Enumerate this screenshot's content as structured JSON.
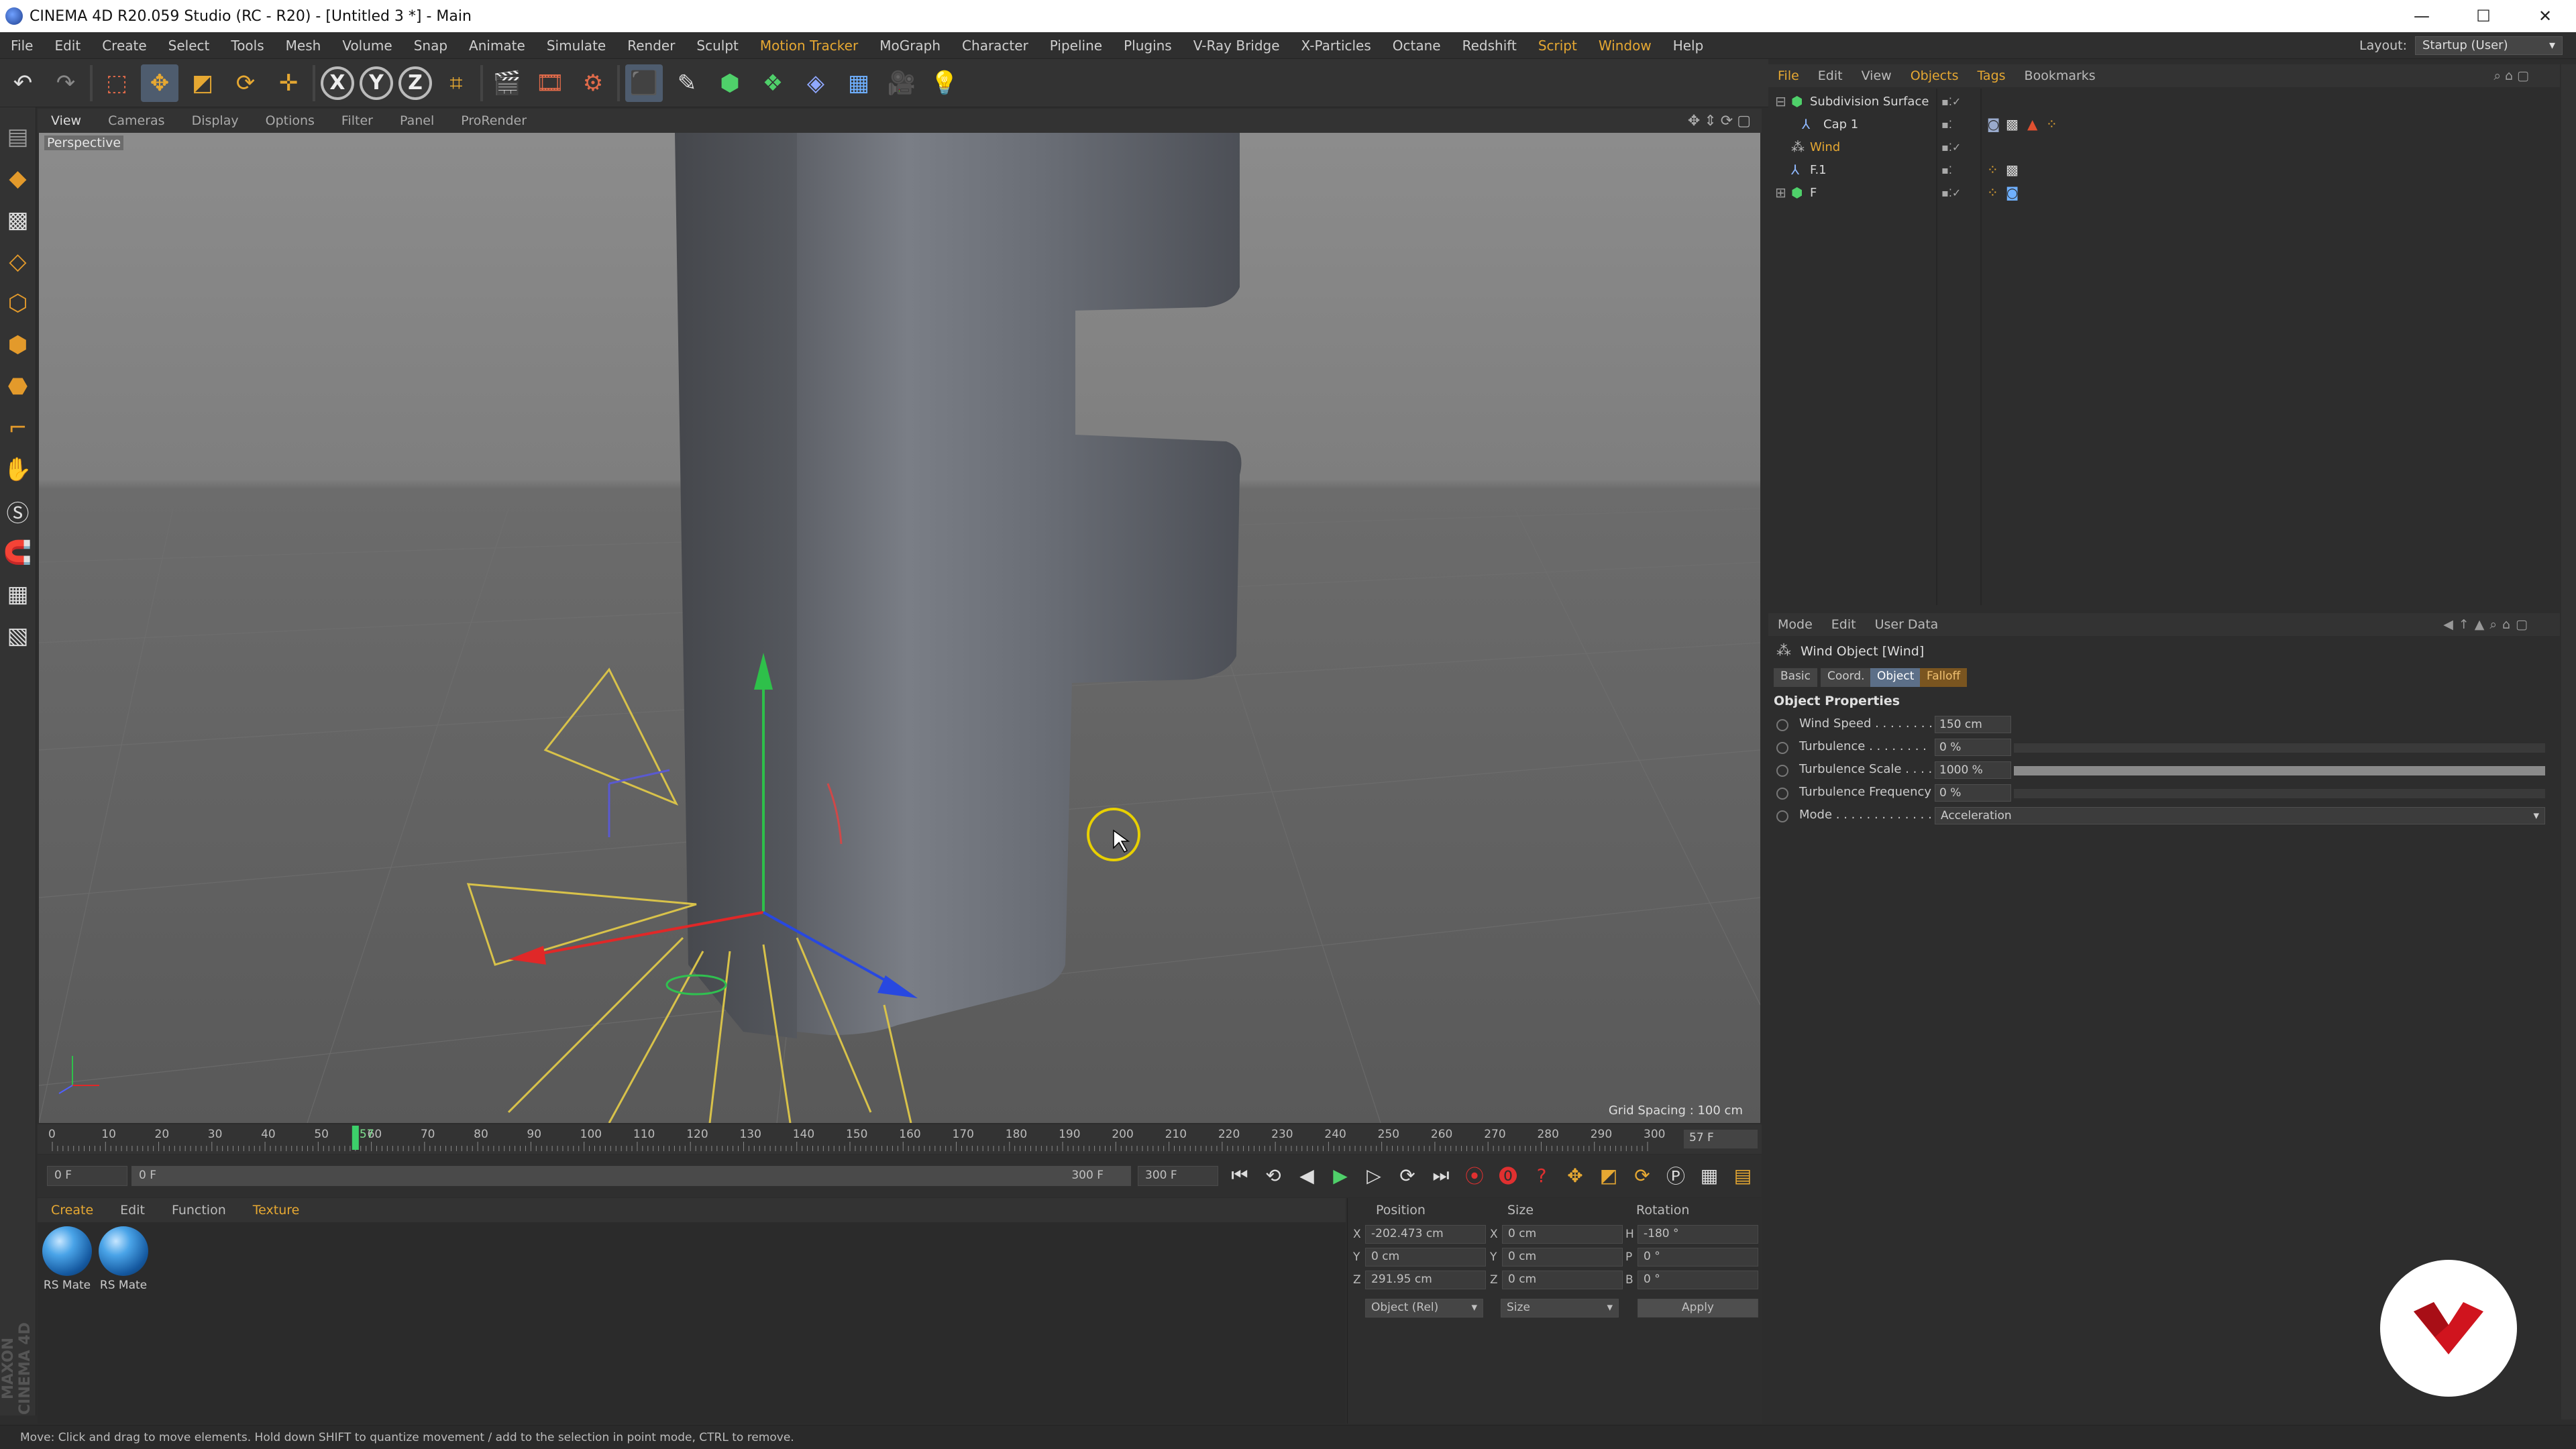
{
  "window": {
    "title": "CINEMA 4D R20.059 Studio (RC - R20) - [Untitled 3 *] - Main",
    "buttons": [
      "—",
      "☐",
      "✕"
    ]
  },
  "menubar": {
    "items": [
      "File",
      "Edit",
      "Create",
      "Select",
      "Tools",
      "Mesh",
      "Volume",
      "Snap",
      "Animate",
      "Simulate",
      "Render",
      "Sculpt",
      "Motion Tracker",
      "MoGraph",
      "Character",
      "Pipeline",
      "Plugins",
      "V-Ray Bridge",
      "X-Particles",
      "Octane",
      "Redshift",
      "Script",
      "Window",
      "Help"
    ],
    "layout_label": "Layout:",
    "layout_value": "Startup (User)"
  },
  "viewport": {
    "menus": [
      "View",
      "Cameras",
      "Display",
      "Options",
      "Filter",
      "Panel",
      "ProRender"
    ],
    "label": "Perspective",
    "grid_spacing": "Grid Spacing : 100 cm"
  },
  "timeline": {
    "ticks": [
      "0",
      "10",
      "20",
      "30",
      "40",
      "50",
      "60",
      "70",
      "80",
      "90",
      "100",
      "110",
      "120",
      "130",
      "140",
      "150",
      "160",
      "170",
      "180",
      "190",
      "200",
      "210",
      "220",
      "230",
      "240",
      "250",
      "260",
      "270",
      "280",
      "290",
      "300"
    ],
    "current_marker": "57",
    "current_field": "57 F"
  },
  "playbar": {
    "start_field": "0 F",
    "range_start": "0 F",
    "range_end": "300 F",
    "end_field": "300 F"
  },
  "materials": {
    "menus": [
      "Create",
      "Edit",
      "Function",
      "Texture"
    ],
    "items": [
      {
        "label": "RS Mate"
      },
      {
        "label": "RS Mate"
      }
    ]
  },
  "brand_vertical": "MAXON CINEMA 4D",
  "coordinates": {
    "headers": [
      "Position",
      "Size",
      "Rotation"
    ],
    "rows": [
      {
        "axis": "X",
        "pos": "-202.473 cm",
        "size_axis": "X",
        "size": "0 cm",
        "rot_axis": "H",
        "rot": "-180 °"
      },
      {
        "axis": "Y",
        "pos": "0 cm",
        "size_axis": "Y",
        "size": "0 cm",
        "rot_axis": "P",
        "rot": "0 °"
      },
      {
        "axis": "Z",
        "pos": "291.95 cm",
        "size_axis": "Z",
        "size": "0 cm",
        "rot_axis": "B",
        "rot": "0 °"
      }
    ],
    "mode_select": "Object (Rel)",
    "size_select": "Size",
    "apply": "Apply"
  },
  "object_manager": {
    "menus": [
      "File",
      "Edit",
      "View",
      "Objects",
      "Tags",
      "Bookmarks"
    ],
    "objects": [
      {
        "name": "Subdivision Surface"
      },
      {
        "name": "Cap 1"
      },
      {
        "name": "Wind"
      },
      {
        "name": "F.1"
      },
      {
        "name": "F"
      }
    ]
  },
  "attribute_manager": {
    "menus": [
      "Mode",
      "Edit",
      "User Data"
    ],
    "title": "Wind Object [Wind]",
    "tabs": [
      "Basic",
      "Coord.",
      "Object",
      "Falloff"
    ],
    "section": "Object Properties",
    "props": [
      {
        "label": "Wind Speed . . . . . . . .",
        "value": "150 cm"
      },
      {
        "label": "Turbulence . . . . . . . .",
        "value": "0 %",
        "slider": 0.0
      },
      {
        "label": "Turbulence Scale . . . .",
        "value": "1000 %",
        "slider": 1.0
      },
      {
        "label": "Turbulence Frequency",
        "value": "0 %",
        "slider": 0.0
      }
    ],
    "mode_label": "Mode . . . . . . . . . . . . .",
    "mode_value": "Acceleration"
  },
  "statusbar": {
    "text": "Move: Click and drag to move elements. Hold down SHIFT to quantize movement / add to the selection in point mode, CTRL to remove."
  }
}
